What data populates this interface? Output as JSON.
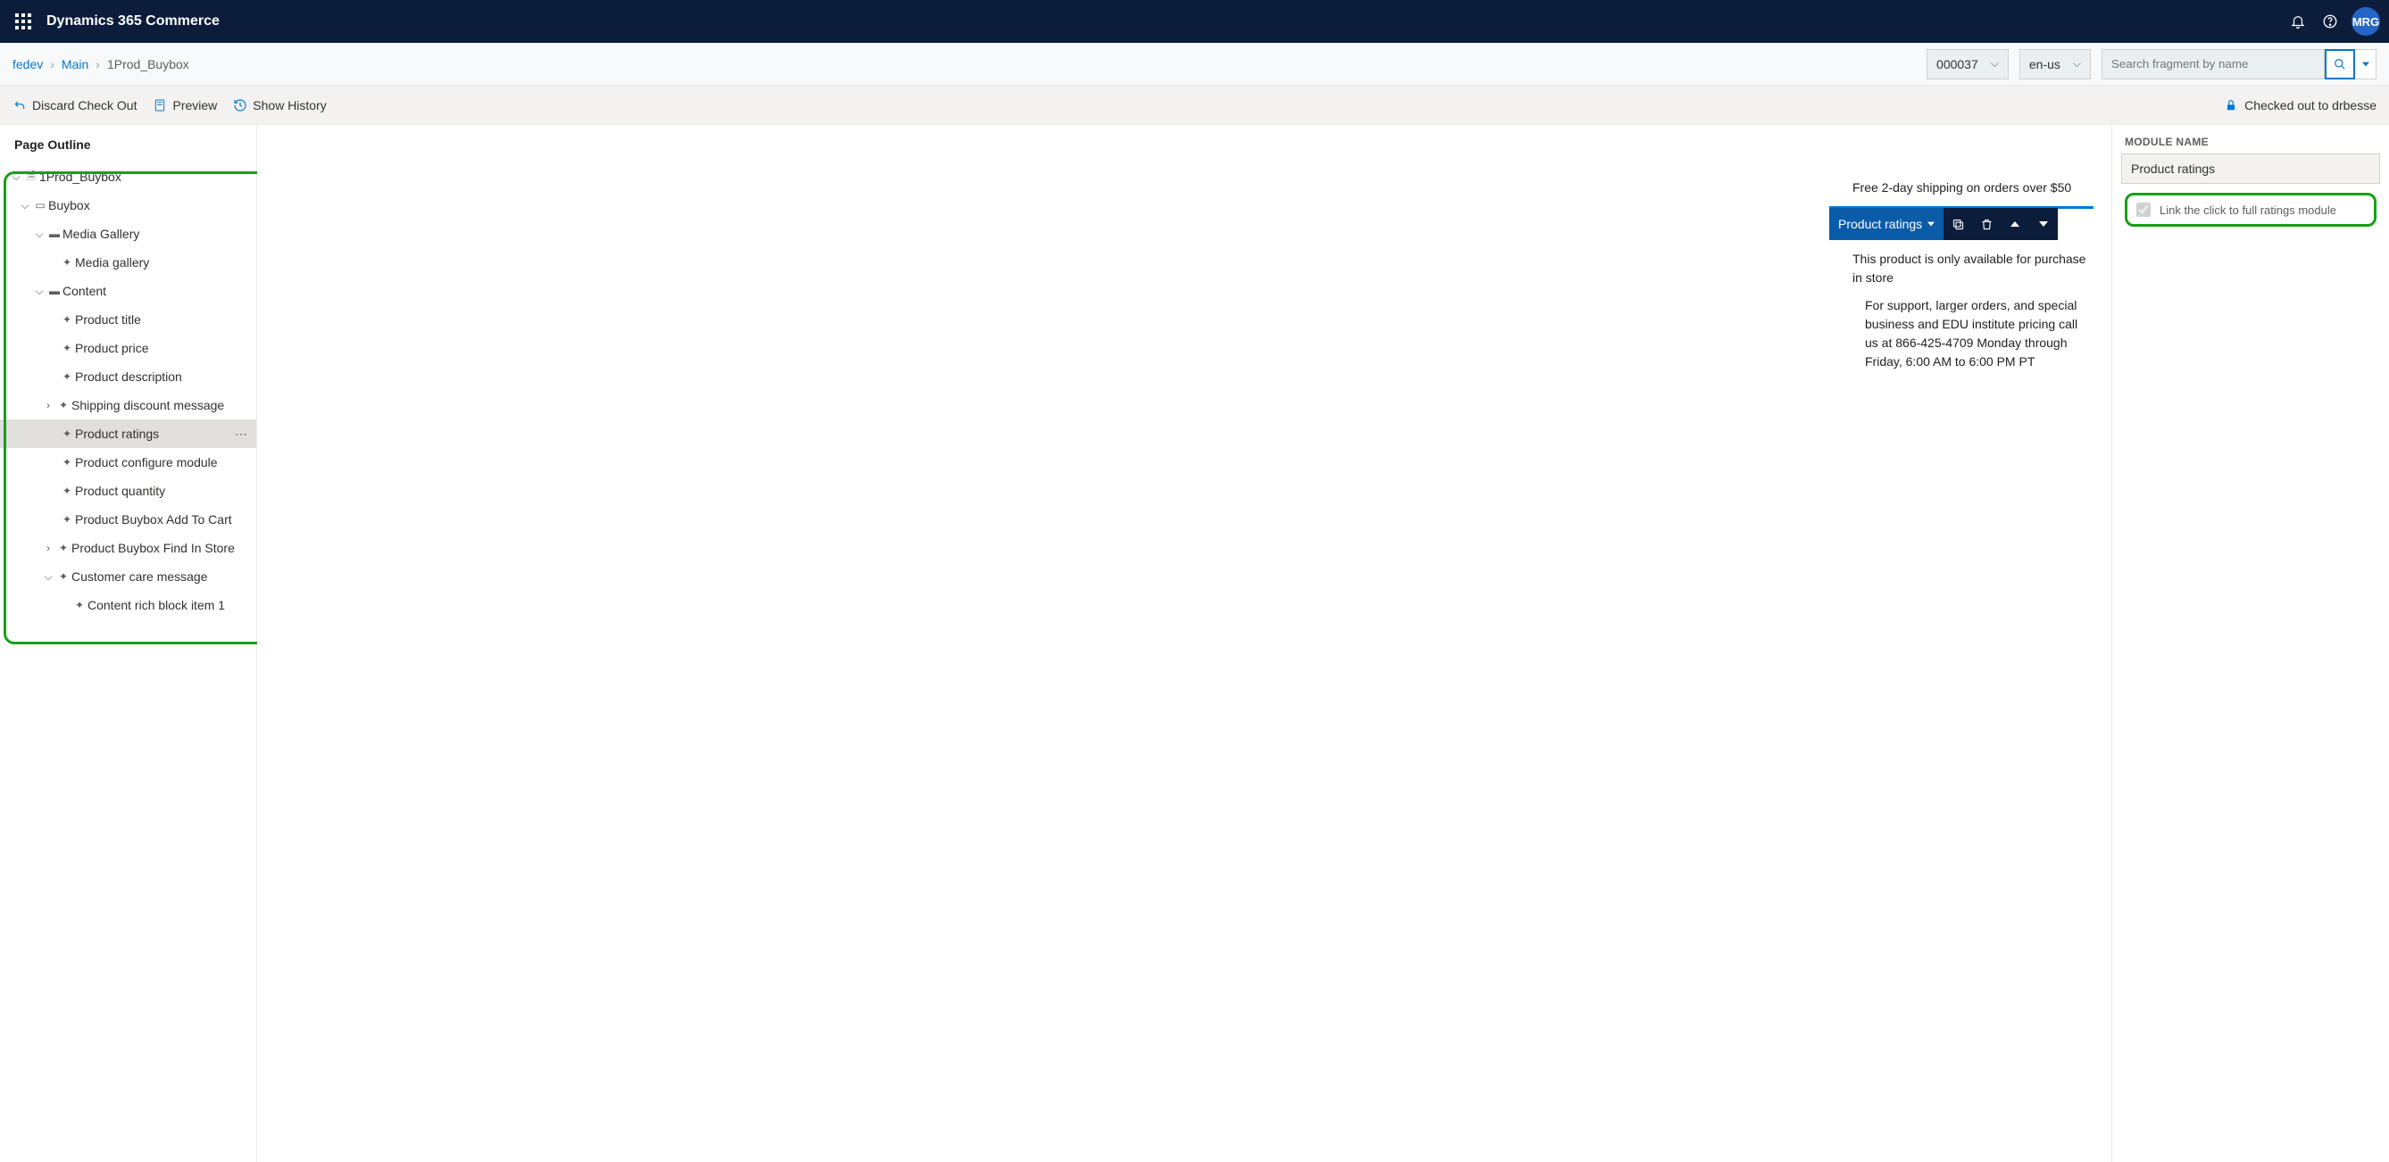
{
  "topbar": {
    "app_title": "Dynamics 365 Commerce",
    "avatar": "MRG"
  },
  "breadcrumb": {
    "root": "fedev",
    "section": "Main",
    "page": "1Prod_Buybox"
  },
  "selectors": {
    "site_id": "000037",
    "locale": "en-us"
  },
  "search": {
    "placeholder": "Search fragment by name"
  },
  "commands": {
    "discard": "Discard Check Out",
    "preview": "Preview",
    "history": "Show History",
    "lock_status": "Checked out to drbesse"
  },
  "outline": {
    "title": "Page Outline",
    "root": "1Prod_Buybox",
    "buybox": "Buybox",
    "media_gallery_slot": "Media Gallery",
    "media_gallery_mod": "Media gallery",
    "content_slot": "Content",
    "items": {
      "product_title": "Product title",
      "product_price": "Product price",
      "product_description": "Product description",
      "shipping_discount": "Shipping discount message",
      "product_ratings": "Product ratings",
      "product_configure": "Product configure module",
      "product_quantity": "Product quantity",
      "add_to_cart": "Product Buybox Add To Cart",
      "find_in_store": "Product Buybox Find In Store",
      "customer_care": "Customer care message",
      "rich_block": "Content rich block item 1"
    }
  },
  "canvas": {
    "shipping_msg": "Free 2-day shipping on orders over $50",
    "module_label": "Product ratings",
    "store_only": "This product is only available for purchase in store",
    "support": "For support, larger orders, and special business and EDU institute pricing call us at 866-425-4709 Monday through Friday, 6:00 AM to 6:00 PM PT"
  },
  "right": {
    "section_label": "MODULE NAME",
    "module_name": "Product ratings",
    "prop_label": "Link the click to full ratings module"
  }
}
